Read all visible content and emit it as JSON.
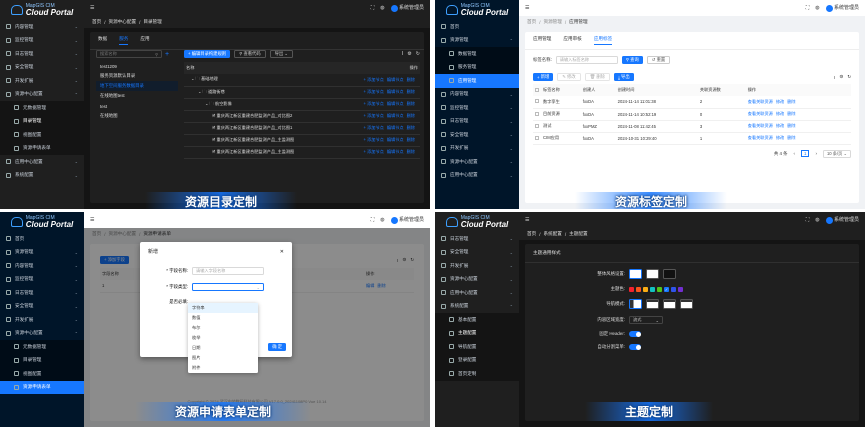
{
  "brand": {
    "line1": "MapGIS CIM",
    "line2": "Cloud Portal"
  },
  "user": "系统管理员",
  "captions": [
    "资源目录定制",
    "资源标签定制",
    "资源申请表单定制",
    "主题定制"
  ],
  "panel1": {
    "nav": [
      {
        "label": "内容管理",
        "type": "group"
      },
      {
        "label": "监控管理",
        "type": "group"
      },
      {
        "label": "日志管理",
        "type": "group"
      },
      {
        "label": "安全管理",
        "type": "group"
      },
      {
        "label": "开发扩展",
        "type": "group"
      },
      {
        "label": "资源中心配置",
        "type": "group-open"
      },
      {
        "label": "元数据管理",
        "type": "sub"
      },
      {
        "label": "目录管理",
        "type": "sub-active"
      },
      {
        "label": "视图配置",
        "type": "sub"
      },
      {
        "label": "资源申请表单",
        "type": "sub"
      },
      {
        "label": "应用中心配置",
        "type": "group"
      },
      {
        "label": "系统配置",
        "type": "group"
      }
    ],
    "breadcrumb": [
      "首页",
      "资源中心配置",
      "目录管理"
    ],
    "tabs": [
      "数据",
      "服务",
      "应用"
    ],
    "active_tab": "服务",
    "search_placeholder": "搜索名称",
    "tree": [
      "test1209",
      "服务资源默认目录",
      "地下空间服务数据目录",
      "在线地图test",
      "test",
      "在线地图"
    ],
    "tree_active": 2,
    "toolbar": {
      "add": "+ 编辑目录构建规则",
      "query": "查看代码",
      "export": "导出"
    },
    "columns": [
      "名称",
      "操作"
    ],
    "rows": [
      {
        "name": "基础地理",
        "indent": 1
      },
      {
        "name": "道路街巷",
        "indent": 2
      },
      {
        "name": "航空影像",
        "indent": 3
      },
      {
        "name": "重庆两江新区重建合肥监测产品_对比图2",
        "indent": 4
      },
      {
        "name": "重庆两江新区重建合肥监测产品_对比图1",
        "indent": 4
      },
      {
        "name": "重庆两江新区重建合肥监测产品_主监测图",
        "indent": 4
      },
      {
        "name": "重庆两江新区重建合肥监测产品_主监测图",
        "indent": 4
      }
    ],
    "actions": [
      "+ 添加节点",
      "编辑节点",
      "删除"
    ]
  },
  "panel2": {
    "nav": [
      {
        "label": "首页",
        "type": "plain"
      },
      {
        "label": "资源管理",
        "type": "group-open"
      },
      {
        "label": "数据管理",
        "type": "sub"
      },
      {
        "label": "服务管理",
        "type": "sub"
      },
      {
        "label": "应用管理",
        "type": "sub-active"
      },
      {
        "label": "内容管理",
        "type": "group"
      },
      {
        "label": "监控管理",
        "type": "group"
      },
      {
        "label": "日志管理",
        "type": "group"
      },
      {
        "label": "安全管理",
        "type": "group"
      },
      {
        "label": "开发扩展",
        "type": "group"
      },
      {
        "label": "资源中心配置",
        "type": "group"
      },
      {
        "label": "应用中心配置",
        "type": "group"
      }
    ],
    "breadcrumb": [
      "首页",
      "资源管理",
      "应用管理"
    ],
    "tabs": [
      "应用管理",
      "应用审核",
      "应用标签"
    ],
    "active_tab": "应用标签",
    "filter_label": "标签名称:",
    "filter_placeholder": "请输入标签名称",
    "search_btn": "查询",
    "reset_btn": "重置",
    "toolbar": [
      "新增",
      "修改",
      "删除",
      "导出"
    ],
    "columns": [
      "标签名称",
      "创建人",
      "创建时间",
      "关联资源数",
      "操作"
    ],
    "rows": [
      {
        "name": "数字孪生",
        "creator": "fxxDA",
        "time": "2024-11-14 11:01:38",
        "count": "2"
      },
      {
        "name": "目前资源",
        "creator": "fxxDA",
        "time": "2024-11-14 10:52:19",
        "count": "0"
      },
      {
        "name": "测试",
        "creator": "fxxPMZ",
        "time": "2024-11-08 11:42:45",
        "count": "3"
      },
      {
        "name": "CIM应用",
        "creator": "fxxDA",
        "time": "2024-10-31 10:29:40",
        "count": "1"
      }
    ],
    "row_actions": [
      "查看关联资源",
      "修改",
      "删除"
    ],
    "pagination": {
      "total": "共 4 条",
      "page": "1",
      "size": "10 条/页"
    }
  },
  "panel3": {
    "nav": [
      {
        "label": "首页",
        "type": "plain"
      },
      {
        "label": "资源管理",
        "type": "group"
      },
      {
        "label": "内容管理",
        "type": "group"
      },
      {
        "label": "监控管理",
        "type": "group"
      },
      {
        "label": "日志管理",
        "type": "group"
      },
      {
        "label": "安全管理",
        "type": "group"
      },
      {
        "label": "开发扩展",
        "type": "group"
      },
      {
        "label": "资源中心配置",
        "type": "group-open"
      },
      {
        "label": "元数据管理",
        "type": "sub"
      },
      {
        "label": "目录管理",
        "type": "sub"
      },
      {
        "label": "视图配置",
        "type": "sub"
      },
      {
        "label": "资源申请表单",
        "type": "sub-active"
      }
    ],
    "breadcrumb": [
      "首页",
      "资源中心配置",
      "资源申请表单"
    ],
    "add_field": "+ 添加字段",
    "columns": [
      "字段名称",
      "操作"
    ],
    "row_index": "1",
    "row_actions": [
      "编辑",
      "删除"
    ],
    "modal": {
      "title": "新增",
      "field_name_label": "* 字段名称:",
      "field_name_placeholder": "请输入字段名称",
      "field_type_label": "* 字段类型:",
      "required_label": "是否必填:",
      "options": [
        "字符串",
        "数值",
        "布尔",
        "枚举",
        "日期",
        "图片",
        "附件"
      ],
      "confirm": "确 定"
    },
    "footer": "Copyright © 2024 武汉中地数码科技有限公司 V17.0.0_20241108P0 Vue 10.14"
  },
  "panel4": {
    "nav": [
      {
        "label": "日志管理",
        "type": "group"
      },
      {
        "label": "安全管理",
        "type": "group"
      },
      {
        "label": "开发扩展",
        "type": "group"
      },
      {
        "label": "资源中心配置",
        "type": "group"
      },
      {
        "label": "应用中心配置",
        "type": "group"
      },
      {
        "label": "系统配置",
        "type": "group-open"
      },
      {
        "label": "基本配置",
        "type": "sub"
      },
      {
        "label": "主题配置",
        "type": "sub-active"
      },
      {
        "label": "导航配置",
        "type": "sub"
      },
      {
        "label": "登录配置",
        "type": "sub"
      },
      {
        "label": "首页定制",
        "type": "sub"
      }
    ],
    "breadcrumb": [
      "首页",
      "系统配置",
      "主题配置"
    ],
    "section_title": "主题通用样式",
    "labels": {
      "style": "整体风格设置:",
      "color": "主题色:",
      "nav_mode": "导航模式:",
      "content_width": "内容区域宽度:",
      "fixed_header": "固定 Header:",
      "auto_split": "自动分割菜单:"
    },
    "content_width_value": "流式",
    "theme_colors": [
      "#f5222d",
      "#fa541c",
      "#faad14",
      "#13c2c2",
      "#52c41a",
      "#1677ff",
      "#2f54eb",
      "#722ed1"
    ],
    "active_color": 5
  }
}
